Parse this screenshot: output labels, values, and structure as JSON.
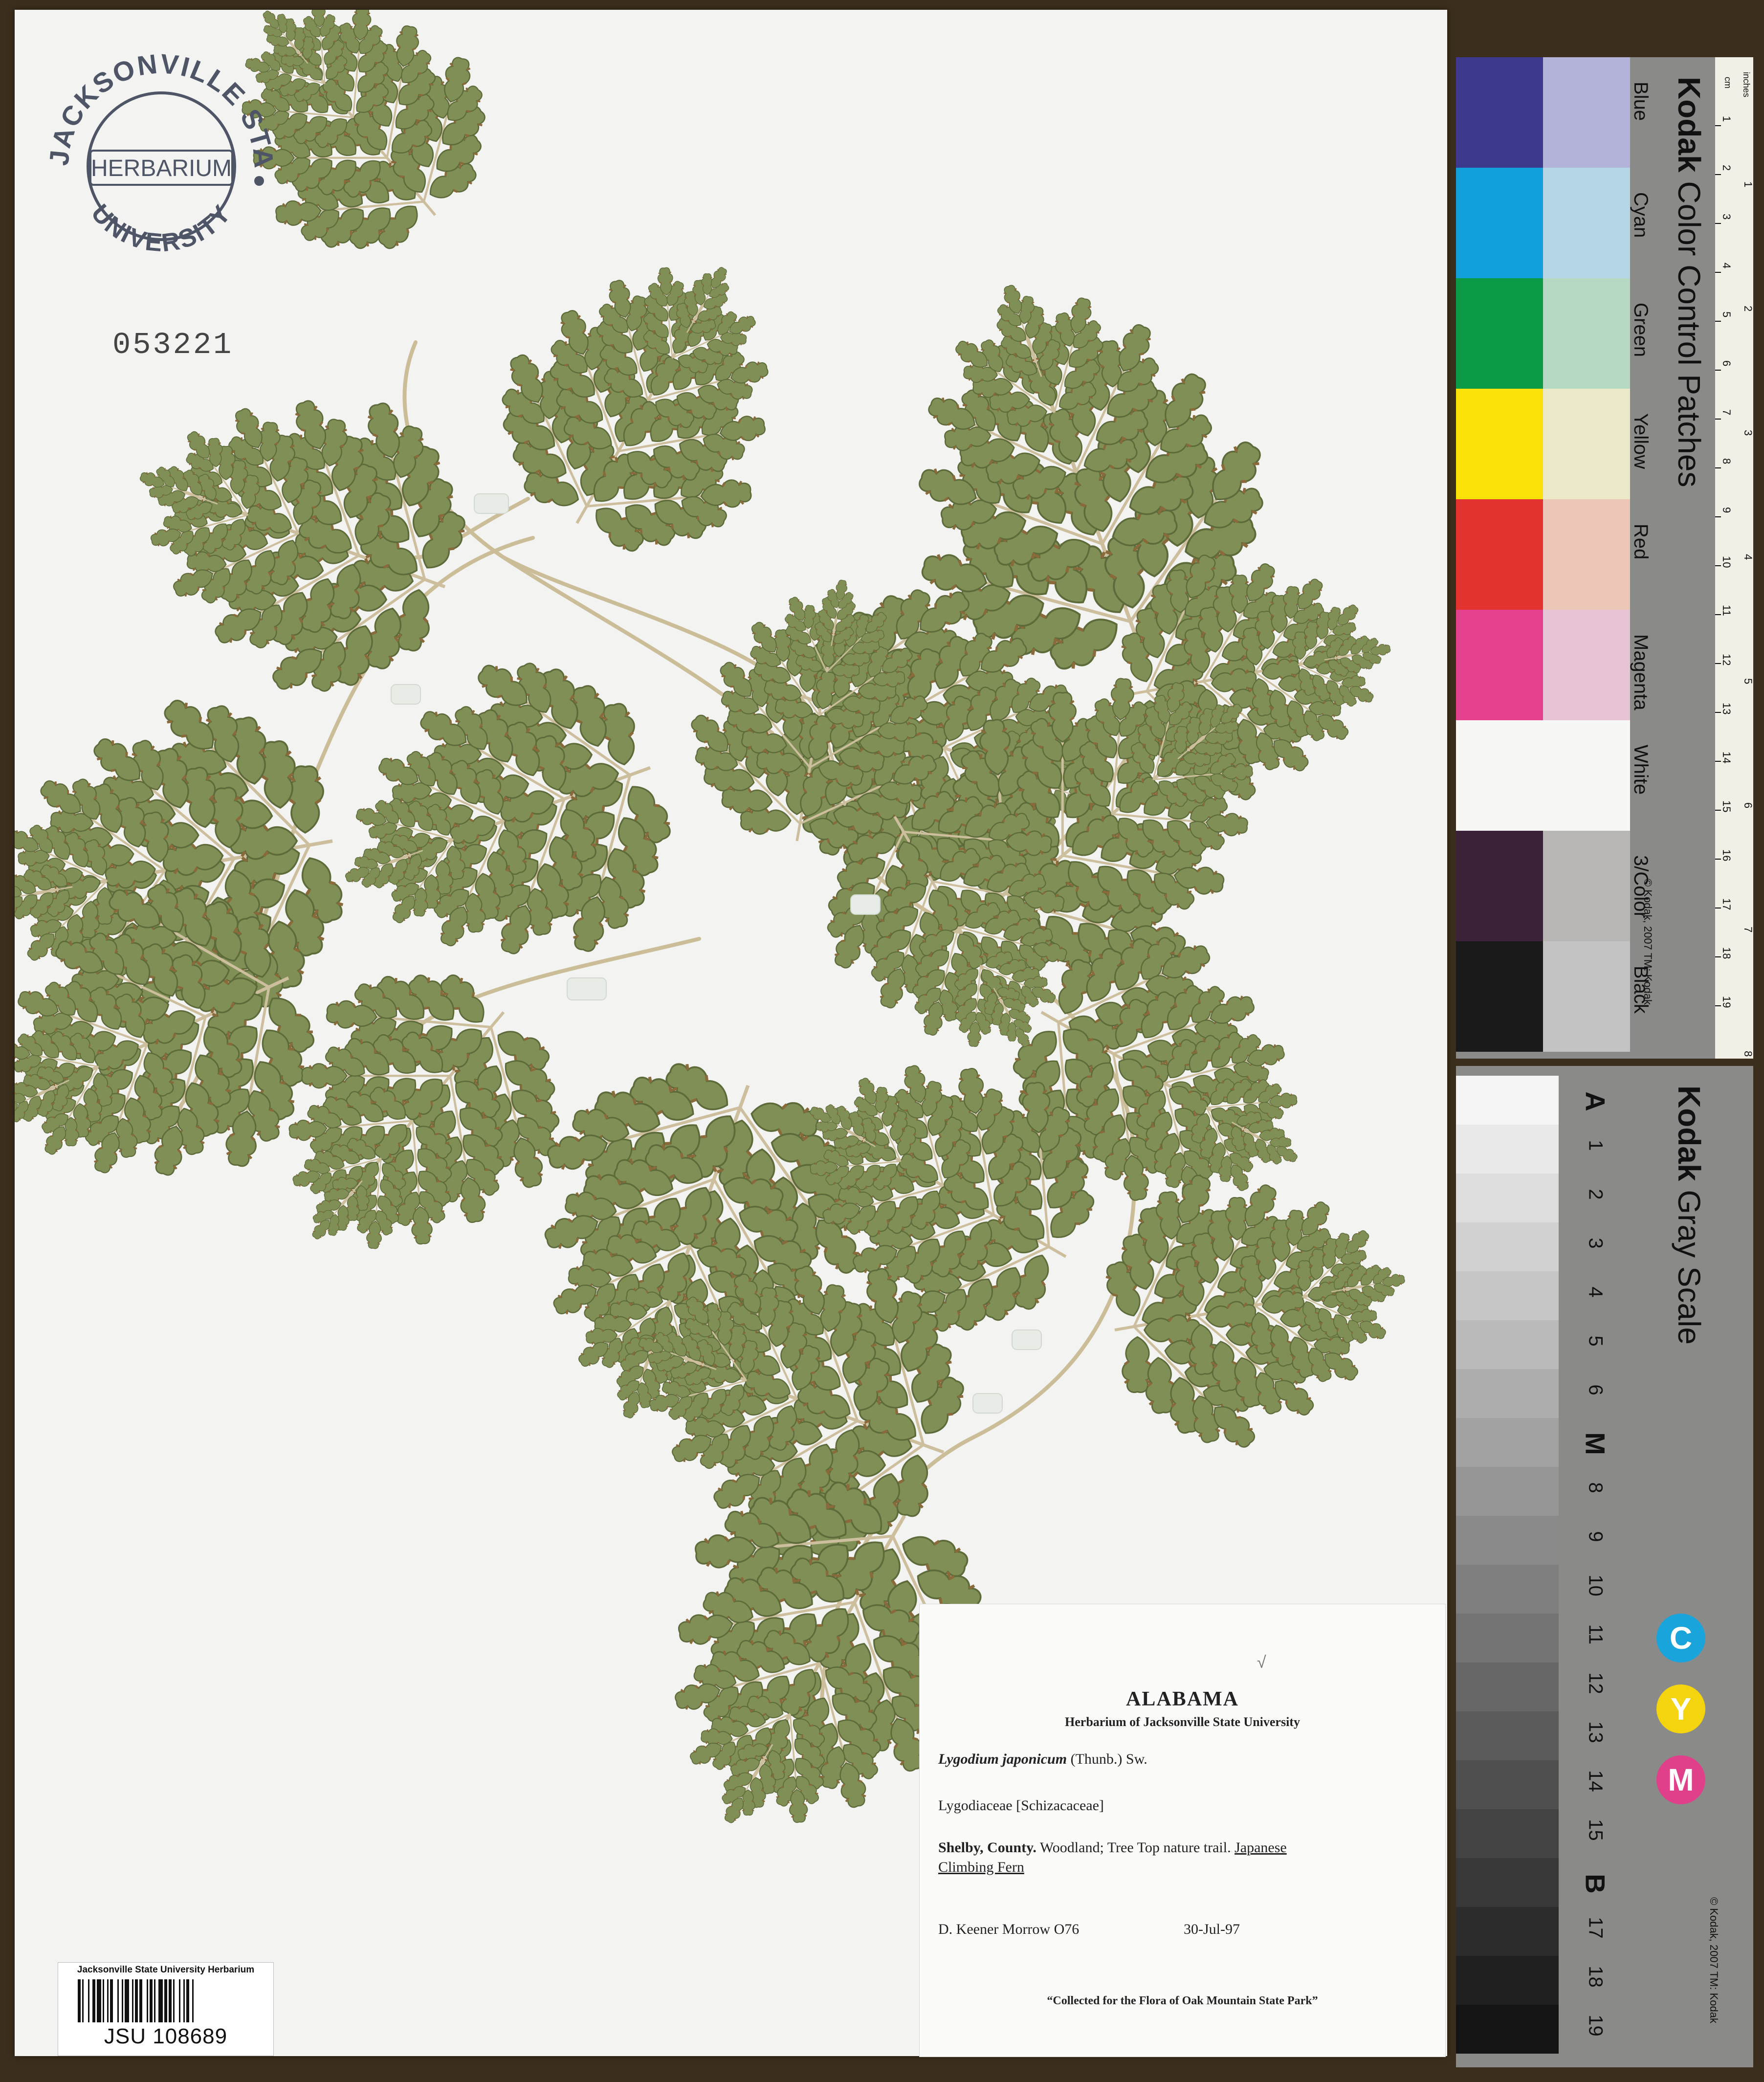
{
  "stamp": {
    "top_text": "JACKSONVILLE STATE",
    "center_text": "HERBARIUM",
    "bottom_text": "UNIVERSITY"
  },
  "accession_number": "053221",
  "label": {
    "state": "ALABAMA",
    "herbarium": "Herbarium of Jacksonville State University",
    "genus_species": "Lygodium japonicum",
    "authority": "(Thunb.) Sw.",
    "family": "Lygodiaceae [Schizacaceae]",
    "county": "Shelby, County.",
    "locality": "Woodland; Tree Top nature trail.",
    "common_name_1": "Japanese",
    "common_name_2": "Climbing Fern",
    "collector": "D. Keener Morrow O76",
    "date": "30-Jul-97",
    "note": "“Collected for the Flora of Oak Mountain State Park”",
    "check_mark": "√"
  },
  "barcode": {
    "title": "Jacksonville State University Herbarium",
    "number": "JSU 108689"
  },
  "color_card": {
    "brand": "Kodak",
    "title": "Color Control Patches",
    "copyright": "© Kodak, 2007 TM: Kodak",
    "patches": [
      {
        "name": "Blue",
        "dark": "#3d3a8e",
        "light": "#b3b2d8"
      },
      {
        "name": "Cyan",
        "dark": "#129fdc",
        "light": "#b5d6e6"
      },
      {
        "name": "Green",
        "dark": "#0d9a47",
        "light": "#b4d8c1"
      },
      {
        "name": "Yellow",
        "dark": "#fbe30a",
        "light": "#ece9c8"
      },
      {
        "name": "Red",
        "dark": "#e2332f",
        "light": "#ecc7b8"
      },
      {
        "name": "Magenta",
        "dark": "#e3418e",
        "light": "#e6c4d6"
      },
      {
        "name": "White",
        "dark": "#f7f7f5",
        "light": "#f7f7f5"
      },
      {
        "name": "3/Color",
        "dark": "#3b2238",
        "light": "#b9b6b6"
      },
      {
        "name": "Black",
        "dark": "#1a1a1a",
        "light": "#c3c3c3"
      }
    ],
    "ruler_cm": [
      "1",
      "2",
      "3",
      "4",
      "5",
      "6",
      "7",
      "8",
      "9",
      "10",
      "11",
      "12",
      "13",
      "14",
      "15",
      "16",
      "17",
      "18",
      "19"
    ],
    "ruler_inches": [
      "1",
      "2",
      "3",
      "4",
      "5",
      "6",
      "7",
      "8"
    ],
    "ruler_unit_cm": "cm",
    "ruler_unit_in": "inches"
  },
  "gray_card": {
    "brand": "Kodak",
    "title": "Gray Scale",
    "copyright": "© Kodak, 2007 TM: Kodak",
    "steps": [
      "A",
      "1",
      "2",
      "3",
      "4",
      "5",
      "6",
      "M",
      "8",
      "9",
      "10",
      "11",
      "12",
      "13",
      "14",
      "15",
      "B",
      "17",
      "18",
      "19"
    ],
    "cym": [
      {
        "letter": "C",
        "color": "#1aa4dc"
      },
      {
        "letter": "Y",
        "color": "#f3d40f"
      },
      {
        "letter": "M",
        "color": "#e0408a"
      }
    ]
  }
}
